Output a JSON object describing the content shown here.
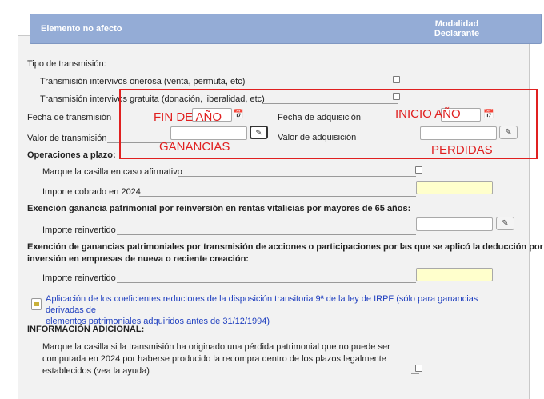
{
  "header": {
    "left": "Elemento no afecto",
    "right_line1": "Modalidad",
    "right_line2": "Declarante"
  },
  "transmission": {
    "type_label": "Tipo de transmisión:",
    "onerosa_label": "Transmisión intervivos onerosa (venta, permuta, etc)",
    "gratuita_label": "Transmisión intervivos gratuita (donación, liberalidad, etc)",
    "fecha_transmision_label": "Fecha de transmisión",
    "fecha_adquisicion_label": "Fecha de adquisición",
    "valor_transmision_label": "Valor de transmisión",
    "valor_adquisicion_label": "Valor de adquisición"
  },
  "operaciones": {
    "title": "Operaciones a plazo:",
    "marque_label": "Marque la casilla en caso afirmativo",
    "importe_label": "Importe cobrado en 2024"
  },
  "exencion_rentas": {
    "title": "Exención ganancia patrimonial por reinversión en rentas vitalicias por mayores de 65 años:",
    "importe_label": "Importe reinvertido"
  },
  "exencion_acciones": {
    "title_line1": "Exención de ganancias patrimoniales por transmisión de acciones o participaciones por las que se aplicó la deducción por",
    "title_line2": "inversión en empresas de nueva o reciente creación:",
    "importe_label": "Importe reinvertido"
  },
  "coeficientes": {
    "link_line1": "Aplicación de los coeficientes reductores de la disposición transitoria 9ª de la ley de IRPF (sólo para ganancias derivadas de",
    "link_line2": "elementos patrimoniales adquiridos antes de 31/12/1994)"
  },
  "informacion": {
    "title": "INFORMACIÓN ADICIONAL:",
    "line1": "Marque la casilla si la transmisión ha originado una pérdida patrimonial que no puede ser",
    "line2": "computada en 2024 por haberse producido la recompra dentro de los plazos legalmente",
    "line3": "establecidos (vea la ayuda)"
  },
  "annotations": {
    "fin": "FIN DE AÑO",
    "inicio": "INICIO AÑO",
    "ganancias": "GANANCIAS",
    "perdidas": "PERDIDAS"
  },
  "icons": {
    "calendar": "calendar-icon",
    "pencil": "pencil-icon",
    "document": "document-icon"
  },
  "colors": {
    "header_bg": "#94acd6",
    "annotation": "#e02020",
    "link": "#1f3fbf",
    "highlight_input": "#ffffcc"
  }
}
